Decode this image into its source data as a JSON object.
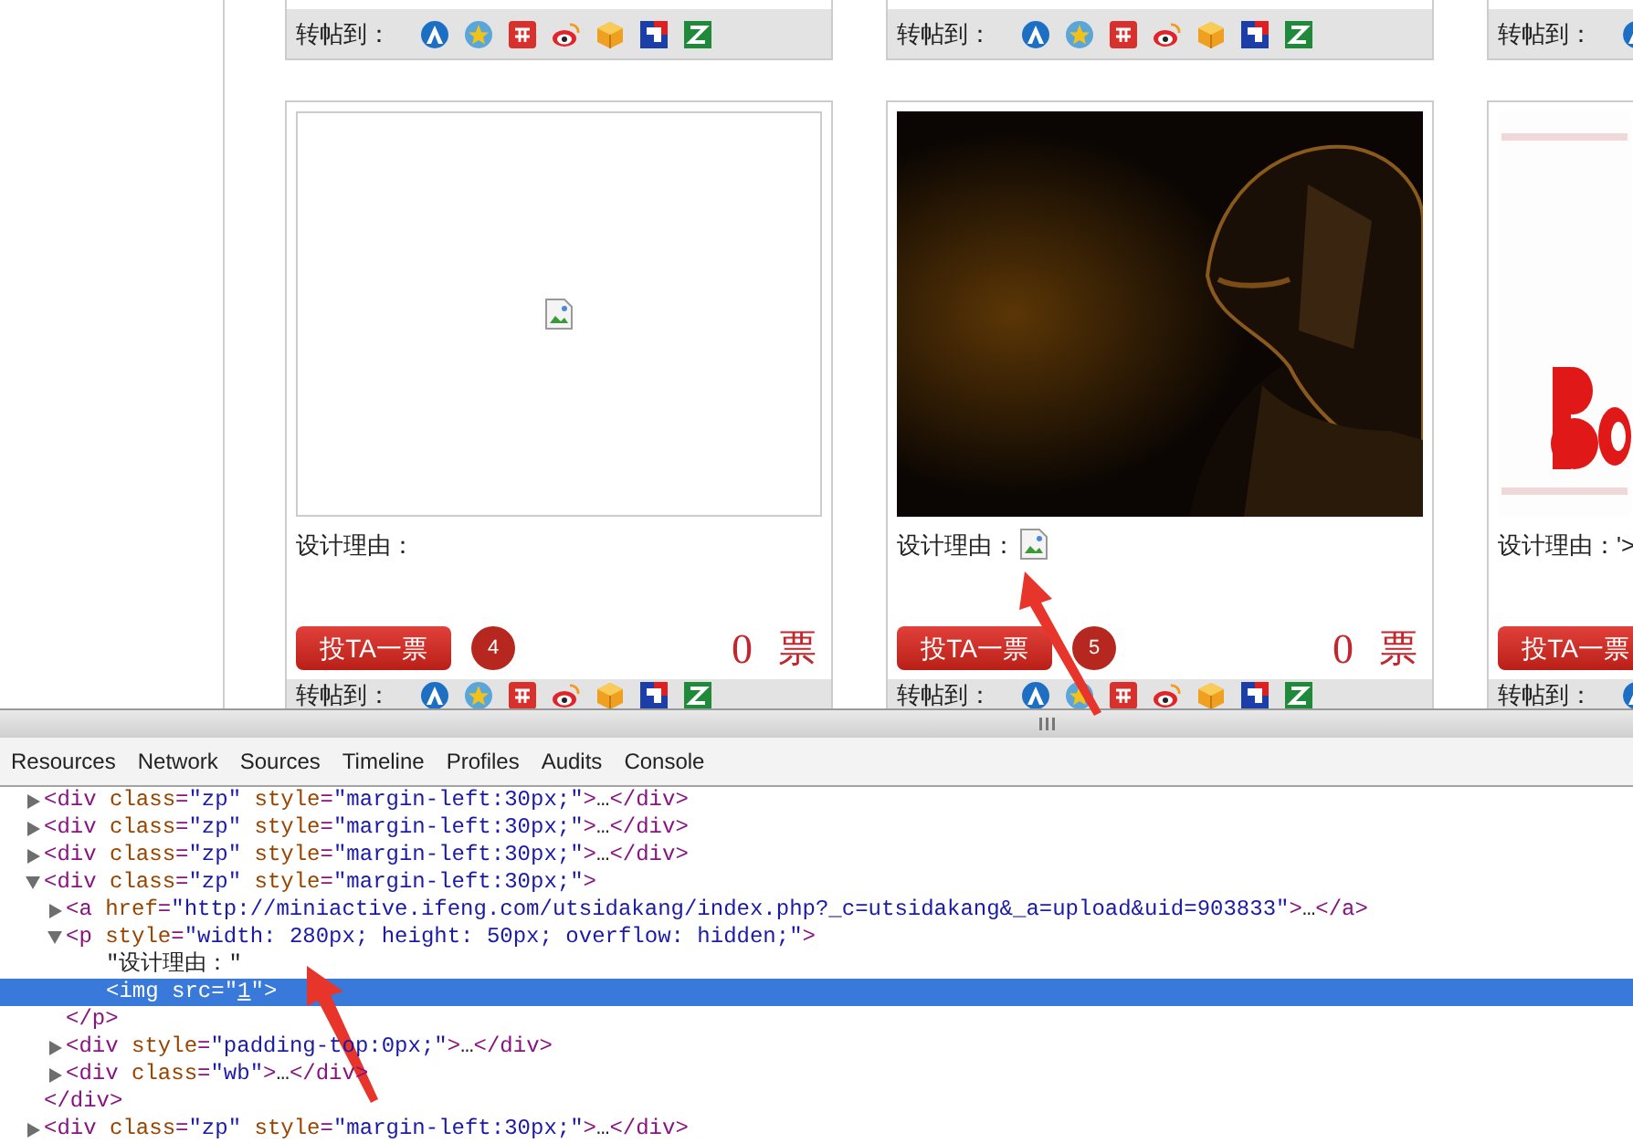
{
  "top_cards": [
    {
      "share_label": "转帖到："
    },
    {
      "share_label": "转帖到："
    },
    {
      "share_label": "转帖到："
    }
  ],
  "cards": [
    {
      "image": {
        "kind": "broken_image"
      },
      "reason_label": "设计理由：",
      "reason_image": false,
      "vote_button": "投TA一票",
      "number": "4",
      "votes": "0",
      "votes_unit": "票",
      "share_label": "转帖到："
    },
    {
      "reason_label": "设计理由：",
      "reason_image": true,
      "vote_button": "投TA一票",
      "number": "5",
      "votes": "0",
      "votes_unit": "票",
      "share_label": "转帖到："
    },
    {
      "reason_label": "设计理由：'>",
      "reason_image": false,
      "vote_button": "投TA一票",
      "share_label": "转帖到："
    }
  ],
  "devtools": {
    "tabs": [
      {
        "label": "Resources",
        "selected": false
      },
      {
        "label": "Network",
        "selected": false
      },
      {
        "label": "Sources",
        "selected": false
      },
      {
        "label": "Timeline",
        "selected": false
      },
      {
        "label": "Profiles",
        "selected": false
      },
      {
        "label": "Audits",
        "selected": false
      },
      {
        "label": "Console",
        "selected": false
      }
    ],
    "dom_tree": [
      {
        "kind": "element",
        "expanded": false,
        "selected": false,
        "line": [
          {
            "kind": "tag",
            "text": "<div"
          },
          {
            "kind": "attr",
            "text": " class"
          },
          {
            "kind": "tag",
            "text": "="
          },
          {
            "kind": "val",
            "text": "\"zp\""
          },
          {
            "kind": "attr",
            "text": " style"
          },
          {
            "kind": "tag",
            "text": "="
          },
          {
            "kind": "val",
            "text": "\"margin-left:30px;\""
          },
          {
            "kind": "tag",
            "text": ">"
          },
          {
            "kind": "plain",
            "text": "…"
          },
          {
            "kind": "tag",
            "text": "</div>"
          }
        ]
      },
      {
        "kind": "element",
        "expanded": false,
        "selected": false,
        "line": [
          {
            "kind": "tag",
            "text": "<div"
          },
          {
            "kind": "attr",
            "text": " class"
          },
          {
            "kind": "tag",
            "text": "="
          },
          {
            "kind": "val",
            "text": "\"zp\""
          },
          {
            "kind": "attr",
            "text": " style"
          },
          {
            "kind": "tag",
            "text": "="
          },
          {
            "kind": "val",
            "text": "\"margin-left:30px;\""
          },
          {
            "kind": "tag",
            "text": ">"
          },
          {
            "kind": "plain",
            "text": "…"
          },
          {
            "kind": "tag",
            "text": "</div>"
          }
        ]
      },
      {
        "kind": "element",
        "expanded": false,
        "selected": false,
        "line": [
          {
            "kind": "tag",
            "text": "<div"
          },
          {
            "kind": "attr",
            "text": " class"
          },
          {
            "kind": "tag",
            "text": "="
          },
          {
            "kind": "val",
            "text": "\"zp\""
          },
          {
            "kind": "attr",
            "text": " style"
          },
          {
            "kind": "tag",
            "text": "="
          },
          {
            "kind": "val",
            "text": "\"margin-left:30px;\""
          },
          {
            "kind": "tag",
            "text": ">"
          },
          {
            "kind": "plain",
            "text": "…"
          },
          {
            "kind": "tag",
            "text": "</div>"
          }
        ]
      },
      {
        "kind": "element",
        "expanded": true,
        "selected": false,
        "line": [
          {
            "kind": "tag",
            "text": "<div"
          },
          {
            "kind": "attr",
            "text": " class"
          },
          {
            "kind": "tag",
            "text": "="
          },
          {
            "kind": "val",
            "text": "\"zp\""
          },
          {
            "kind": "attr",
            "text": " style"
          },
          {
            "kind": "tag",
            "text": "="
          },
          {
            "kind": "val",
            "text": "\"margin-left:30px;\""
          },
          {
            "kind": "tag",
            "text": ">"
          }
        ],
        "close": [
          {
            "kind": "tag",
            "text": "</div>"
          }
        ],
        "children": [
          {
            "kind": "element",
            "expanded": false,
            "selected": false,
            "line": [
              {
                "kind": "tag",
                "text": "<a"
              },
              {
                "kind": "attr",
                "text": " href"
              },
              {
                "kind": "tag",
                "text": "="
              },
              {
                "kind": "val",
                "text": "\"http://miniactive.ifeng.com/utsidakang/index.php?_c=utsidakang&_a=upload&uid=903833\""
              },
              {
                "kind": "tag",
                "text": ">"
              },
              {
                "kind": "plain",
                "text": "…"
              },
              {
                "kind": "tag",
                "text": "</a>"
              }
            ]
          },
          {
            "kind": "element",
            "expanded": true,
            "selected": false,
            "line": [
              {
                "kind": "tag",
                "text": "<p"
              },
              {
                "kind": "attr",
                "text": " style"
              },
              {
                "kind": "tag",
                "text": "="
              },
              {
                "kind": "val",
                "text": "\"width: 280px; height: 50px; overflow: hidden;\""
              },
              {
                "kind": "tag",
                "text": ">"
              }
            ],
            "close": [
              {
                "kind": "tag",
                "text": "</p>"
              }
            ],
            "children": [
              {
                "kind": "leaf",
                "selected": false,
                "line": [
                  {
                    "kind": "plain",
                    "text": "\"设计理由：\""
                  }
                ]
              },
              {
                "kind": "leaf",
                "selected": true,
                "line": [
                  {
                    "kind": "tag",
                    "text": "<img"
                  },
                  {
                    "kind": "attr",
                    "text": " src"
                  },
                  {
                    "kind": "tag",
                    "text": "="
                  },
                  {
                    "kind": "val",
                    "text": "\""
                  },
                  {
                    "kind": "link",
                    "text": "1"
                  },
                  {
                    "kind": "val",
                    "text": "\""
                  },
                  {
                    "kind": "tag",
                    "text": ">"
                  }
                ]
              }
            ]
          },
          {
            "kind": "element",
            "expanded": false,
            "selected": false,
            "line": [
              {
                "kind": "tag",
                "text": "<div"
              },
              {
                "kind": "attr",
                "text": " style"
              },
              {
                "kind": "tag",
                "text": "="
              },
              {
                "kind": "val",
                "text": "\"padding-top:0px;\""
              },
              {
                "kind": "tag",
                "text": ">"
              },
              {
                "kind": "plain",
                "text": "…"
              },
              {
                "kind": "tag",
                "text": "</div>"
              }
            ]
          },
          {
            "kind": "element",
            "expanded": false,
            "selected": false,
            "line": [
              {
                "kind": "tag",
                "text": "<div"
              },
              {
                "kind": "attr",
                "text": " class"
              },
              {
                "kind": "tag",
                "text": "="
              },
              {
                "kind": "val",
                "text": "\"wb\""
              },
              {
                "kind": "tag",
                "text": ">"
              },
              {
                "kind": "plain",
                "text": "…"
              },
              {
                "kind": "tag",
                "text": "</div>"
              }
            ]
          }
        ]
      },
      {
        "kind": "element",
        "expanded": false,
        "selected": false,
        "line": [
          {
            "kind": "tag",
            "text": "<div"
          },
          {
            "kind": "attr",
            "text": " class"
          },
          {
            "kind": "tag",
            "text": "="
          },
          {
            "kind": "val",
            "text": "\"zp\""
          },
          {
            "kind": "attr",
            "text": " style"
          },
          {
            "kind": "tag",
            "text": "="
          },
          {
            "kind": "val",
            "text": "\"margin-left:30px;\""
          },
          {
            "kind": "tag",
            "text": ">"
          },
          {
            "kind": "plain",
            "text": "…"
          },
          {
            "kind": "tag",
            "text": "</div>"
          }
        ]
      }
    ]
  }
}
